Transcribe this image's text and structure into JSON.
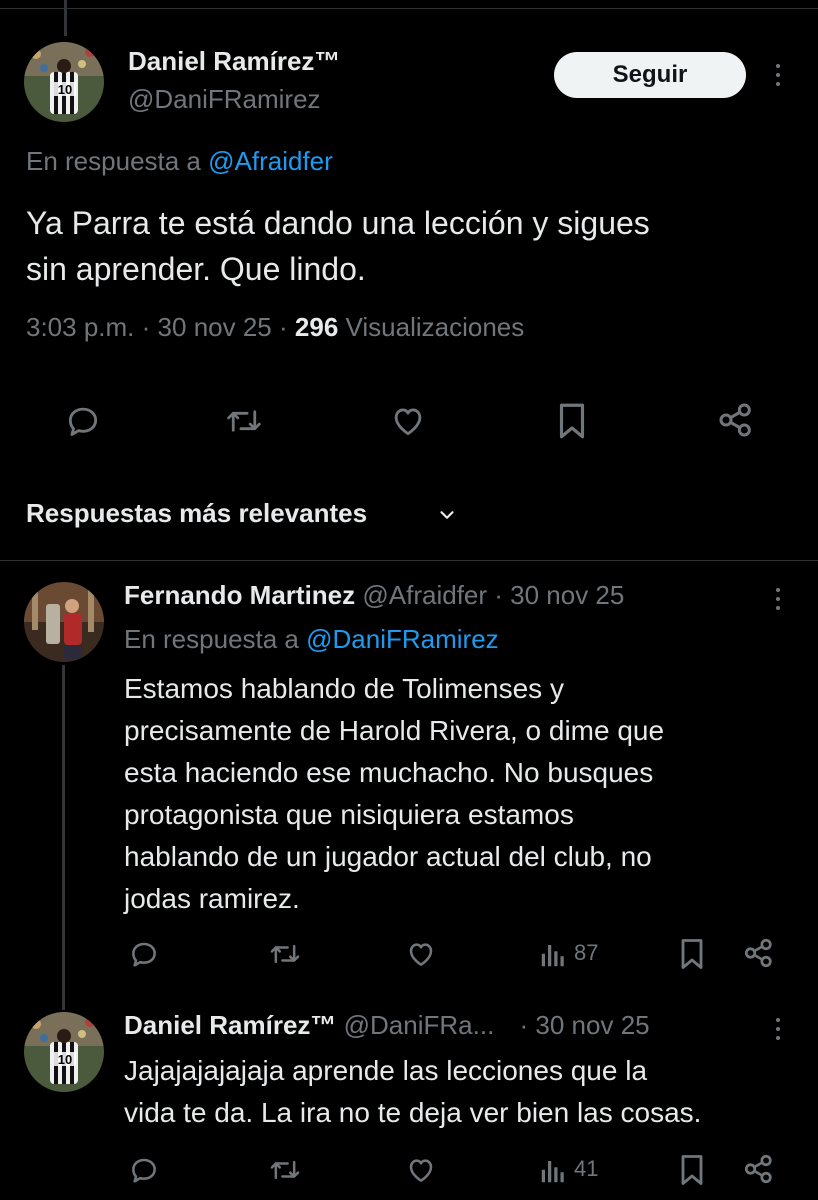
{
  "main_tweet": {
    "author_name": "Daniel Ramírez™",
    "author_handle": "@DaniFRamirez",
    "follow_label": "Seguir",
    "reply_prefix": "En respuesta a",
    "reply_to": "@Afraidfer",
    "text_line1": "Ya Parra te está dando una lección y sigues",
    "text_line2": "sin aprender. Que lindo.",
    "time": "3:03 p.m.",
    "sep": "·",
    "date": "30 nov 25",
    "views_count": "296",
    "views_label": "Visualizaciones",
    "avatar_jersey_number": "10"
  },
  "replies_sort": {
    "label": "Respuestas más relevantes"
  },
  "replies": [
    {
      "author_name": "Fernando Martinez",
      "author_handle": "@Afraidfer",
      "date": "· 30 nov 25",
      "reply_prefix": "En respuesta a",
      "reply_to": "@DaniFRamirez",
      "lines": [
        "Estamos hablando de Tolimenses y",
        "precisamente de Harold Rivera, o dime que",
        "esta haciendo ese muchacho. No busques",
        "protagonista que nisiquiera estamos",
        "hablando de un jugador actual del club, no",
        "jodas ramirez."
      ],
      "views": "87"
    },
    {
      "author_name": "Daniel Ramírez™",
      "author_handle": "@DaniFRa...",
      "date": "· 30 nov 25",
      "lines": [
        "Jajajajajajaja aprende las lecciones que la",
        "vida te da. La ira no te deja ver bien las cosas."
      ],
      "views": "41",
      "avatar_jersey_number": "10"
    }
  ],
  "colors": {
    "background": "#000000",
    "text": "#e7e9ea",
    "muted": "#71767b",
    "link": "#1d9bf0"
  },
  "icons": [
    "reply-icon",
    "retweet-icon",
    "like-icon",
    "bookmark-icon",
    "share-icon",
    "views-icon",
    "more-icon",
    "chevron-down-icon"
  ]
}
